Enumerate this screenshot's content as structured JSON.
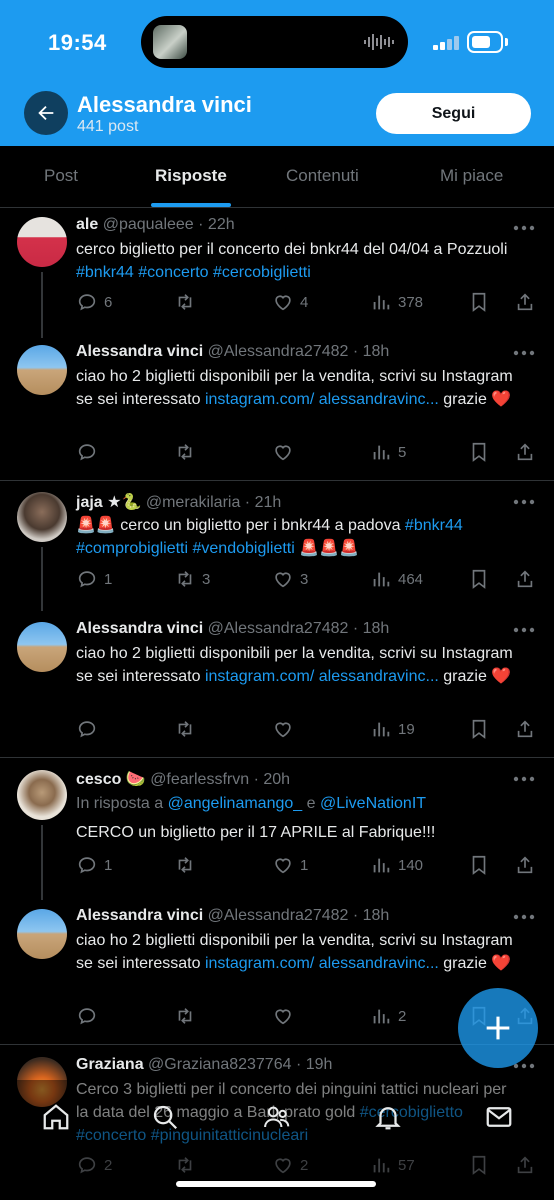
{
  "status_bar": {
    "time": "19:54"
  },
  "header": {
    "name": "Alessandra vinci",
    "post_count": "441 post",
    "follow_label": "Segui"
  },
  "tabs": [
    {
      "label": "Post"
    },
    {
      "label": "Risposte"
    },
    {
      "label": "Contenuti"
    },
    {
      "label": "Mi piace"
    }
  ],
  "posts": [
    {
      "name": "ale",
      "handle": "@paqualeee",
      "time": "· 22h",
      "text": "cerco biglietto per il concerto dei bnkr44 del 04/04 a Pozzuoli ",
      "hashtags": "#bnkr44 #concerto #cercobiglietti",
      "replies": "6",
      "reposts": "",
      "likes": "4",
      "views": "378"
    },
    {
      "name": "Alessandra vinci",
      "handle": "@Alessandra27482",
      "time": "· 18h",
      "text": "ciao ho 2 biglietti disponibili per la vendita, scrivi su Instagram se sei interessato ",
      "link": "instagram.com/ alessandravinc...",
      "suffix": " grazie ❤️",
      "replies": "",
      "reposts": "",
      "likes": "",
      "views": "5"
    },
    {
      "name": "jaja ★🐍",
      "handle": "@merakilaria",
      "time": "· 21h",
      "text": "🚨🚨 cerco un biglietto per i bnkr44 a padova ",
      "hashtags": "#bnkr44 #comprobiglietti #vendobiglietti",
      "suffix": " 🚨🚨🚨",
      "replies": "1",
      "reposts": "3",
      "likes": "3",
      "views": "464"
    },
    {
      "name": "Alessandra vinci",
      "handle": "@Alessandra27482",
      "time": "· 18h",
      "text": "ciao ho 2 biglietti disponibili per la vendita, scrivi su Instagram se sei interessato ",
      "link": "instagram.com/ alessandravinc...",
      "suffix": " grazie ❤️",
      "replies": "",
      "reposts": "",
      "likes": "",
      "views": "19"
    },
    {
      "name": "cesco 🍉",
      "handle": "@fearlessfrvn",
      "time": "· 20h",
      "reply_prefix": "In risposta a ",
      "reply_user1": "@angelinamango_",
      "reply_and": " e ",
      "reply_user2": "@LiveNationIT",
      "text": "CERCO un biglietto per il 17 APRILE al Fabrique!!!",
      "replies": "1",
      "reposts": "",
      "likes": "1",
      "views": "140"
    },
    {
      "name": "Alessandra vinci",
      "handle": "@Alessandra27482",
      "time": "· 18h",
      "text": "ciao ho 2 biglietti disponibili per la vendita, scrivi su Instagram se sei interessato ",
      "link": "instagram.com/ alessandravinc...",
      "suffix": " grazie ❤️",
      "replies": "",
      "reposts": "",
      "likes": "",
      "views": "2"
    },
    {
      "name": "Graziana",
      "handle": "@Graziana8237764",
      "time": "· 19h",
      "text": "Cerco 3 biglietti per il concerto dei pinguini tattici nucleari per la data del 26 maggio a Bari, prato gold ",
      "hashtags": "#cercobiglietto #concerto #pinguinitatticinucleari",
      "replies": "2",
      "reposts": "",
      "likes": "2",
      "views": "57"
    }
  ],
  "colors": {
    "accent": "#1d9bf0",
    "background": "#000000",
    "muted": "#71767b",
    "text": "#e7e9ea"
  }
}
